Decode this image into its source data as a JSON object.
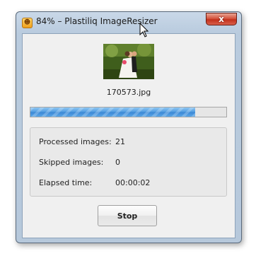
{
  "window": {
    "title": "84% – Plastiliq ImageResizer",
    "close_glyph": "x",
    "app_icon": "smiley-icon",
    "close_icon": "close-icon"
  },
  "thumbnail": {
    "icon": "photo-thumbnail",
    "subject": "wedding couple photo"
  },
  "file": {
    "name": "170573.jpg"
  },
  "progress": {
    "percent": 84,
    "accent": "#4f9be0"
  },
  "stats": {
    "processed": {
      "label": "Processed images:",
      "value": "21"
    },
    "skipped": {
      "label": "Skipped images:",
      "value": "0"
    },
    "elapsed": {
      "label": "Elapsed time:",
      "value": "00:00:02"
    }
  },
  "actions": {
    "stop_label": "Stop"
  },
  "colors": {
    "title_bar": "#c9d8e8",
    "close_button": "#c2301b",
    "content_bg": "#f0f0f0",
    "progress_fill": "#4f9be0"
  }
}
